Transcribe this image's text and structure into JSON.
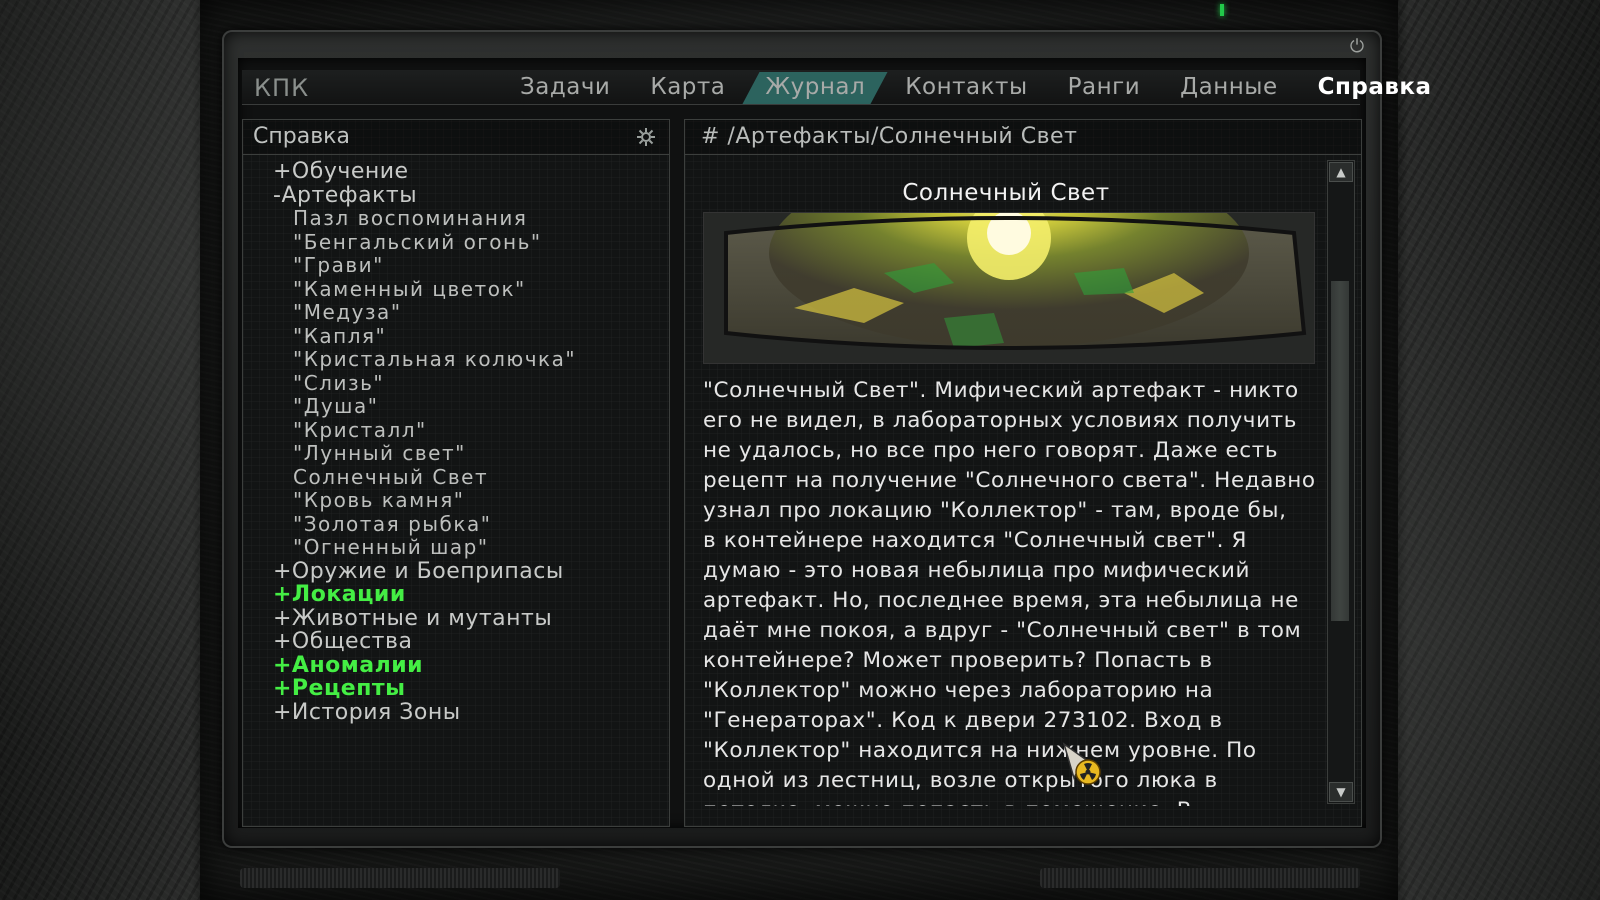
{
  "header": {
    "app_title": "КПК",
    "tabs": [
      {
        "label": "Задачи"
      },
      {
        "label": "Карта"
      },
      {
        "label": "Журнал"
      },
      {
        "label": "Контакты"
      },
      {
        "label": "Ранги"
      },
      {
        "label": "Данные"
      },
      {
        "label": "Справка"
      }
    ],
    "current_tab": "Справка",
    "highlighted_tab": "Журнал"
  },
  "sidebar": {
    "title": "Справка",
    "items": [
      {
        "label": "+Обучение",
        "level": 0,
        "highlight": false
      },
      {
        "label": "-Артефакты",
        "level": 0,
        "highlight": false
      },
      {
        "label": "Пазл воспоминания",
        "level": 1,
        "highlight": false
      },
      {
        "label": "\"Бенгальский огонь\"",
        "level": 1,
        "highlight": false
      },
      {
        "label": "\"Грави\"",
        "level": 1,
        "highlight": false
      },
      {
        "label": "\"Каменный цветок\"",
        "level": 1,
        "highlight": false
      },
      {
        "label": "\"Медуза\"",
        "level": 1,
        "highlight": false
      },
      {
        "label": "\"Капля\"",
        "level": 1,
        "highlight": false
      },
      {
        "label": "\"Кристальная колючка\"",
        "level": 1,
        "highlight": false
      },
      {
        "label": "\"Слизь\"",
        "level": 1,
        "highlight": false
      },
      {
        "label": "\"Душа\"",
        "level": 1,
        "highlight": false
      },
      {
        "label": "\"Кристалл\"",
        "level": 1,
        "highlight": false
      },
      {
        "label": "\"Лунный свет\"",
        "level": 1,
        "highlight": false
      },
      {
        "label": "Солнечный Свет",
        "level": 1,
        "highlight": false
      },
      {
        "label": "\"Кровь камня\"",
        "level": 1,
        "highlight": false
      },
      {
        "label": "\"Золотая рыбка\"",
        "level": 1,
        "highlight": false
      },
      {
        "label": "\"Огненный шар\"",
        "level": 1,
        "highlight": false
      },
      {
        "label": "+Оружие и Боеприпасы",
        "level": 0,
        "highlight": false
      },
      {
        "label": "+Локации",
        "level": 0,
        "highlight": true
      },
      {
        "label": "+Животные и мутанты",
        "level": 0,
        "highlight": false
      },
      {
        "label": "+Общества",
        "level": 0,
        "highlight": false
      },
      {
        "label": "+Аномалии",
        "level": 0,
        "highlight": true
      },
      {
        "label": "+Рецепты",
        "level": 0,
        "highlight": true
      },
      {
        "label": "+История Зоны",
        "level": 0,
        "highlight": false
      }
    ]
  },
  "content": {
    "path": "# /Артефакты/Солнечный Свет",
    "title": "Солнечный Свет",
    "body_lines": [
      "\"Солнечный Свет\". Мифический артефакт - никто",
      "его не видел, в лабораторных условиях получить",
      "не удалось, но все про него говорят. Даже есть",
      "рецепт на получение \"Солнечного света\". Недавно",
      "узнал про локацию \"Коллектор\" - там, вроде бы,",
      "в контейнере находится \"Солнечный свет\". Я",
      "думаю - это новая небылица про мифический",
      "артефакт. Но, последнее время, эта небылица не",
      "даёт мне покоя, а вдруг - \"Солнечный свет\" в том",
      "контейнере? Может проверить? Попасть в",
      "\"Коллектор\" можно через лабораторию на",
      "\"Генераторах\". Код к двери 273102. Вход в",
      "\"Коллектор\" находится на нижнем уровне. По",
      "одной из лестниц, возле открытого люка в",
      "потолке, можно попасть в помещение. В"
    ]
  },
  "colors": {
    "accent_tab": "#2f6b66",
    "highlight_green": "#44ee44",
    "text": "#c8cac8"
  },
  "icons": {
    "power": "power-icon",
    "settings": "settings-gear-icon",
    "scroll_up": "arrow-up-icon",
    "scroll_down": "arrow-down-icon",
    "cursor": "radiation-cursor-icon"
  }
}
